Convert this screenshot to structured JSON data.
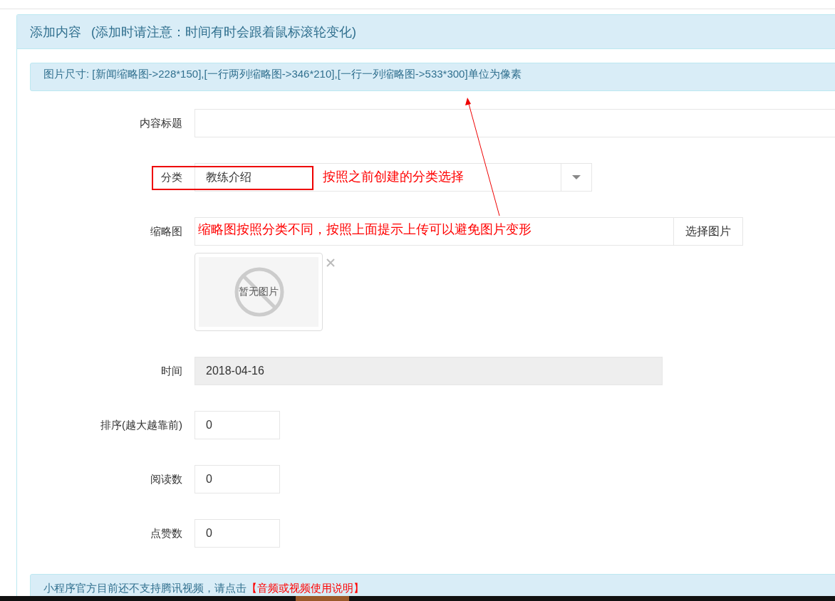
{
  "panel": {
    "title": "添加内容",
    "title_note": "(添加时请注意：时间有时会跟着鼠标滚轮变化)"
  },
  "size_tip": "图片尺寸: [新闻缩略图->228*150],[一行两列缩略图->346*210],[一行一列缩略图->533*300]单位为像素",
  "fields": [
    {
      "kind": "text",
      "label": "内容标题"
    },
    {
      "kind": "select",
      "label": "分类",
      "value": "教练介绍"
    },
    {
      "kind": "image",
      "label": "缩略图",
      "button": "选择图片",
      "preview_text": "暂无图片"
    },
    {
      "kind": "text",
      "label": "时间",
      "value": "2018-04-16",
      "disabled": true,
      "wide": true
    },
    {
      "kind": "text",
      "label": "排序(越大越靠前)",
      "value": "0",
      "short": true
    },
    {
      "kind": "text",
      "label": "阅读数",
      "value": "0",
      "short": true
    },
    {
      "kind": "text",
      "label": "点赞数",
      "value": "0",
      "short": true
    }
  ],
  "video_tip": {
    "text": "小程序官方目前还不支持腾讯视频，请点击",
    "link": "【音频或视频使用说明】"
  },
  "annotations": {
    "select_note": "按照之前创建的分类选择",
    "thumbnail_note": "缩略图按照分类不同，按照上面提示上传可以避免图片变形"
  }
}
